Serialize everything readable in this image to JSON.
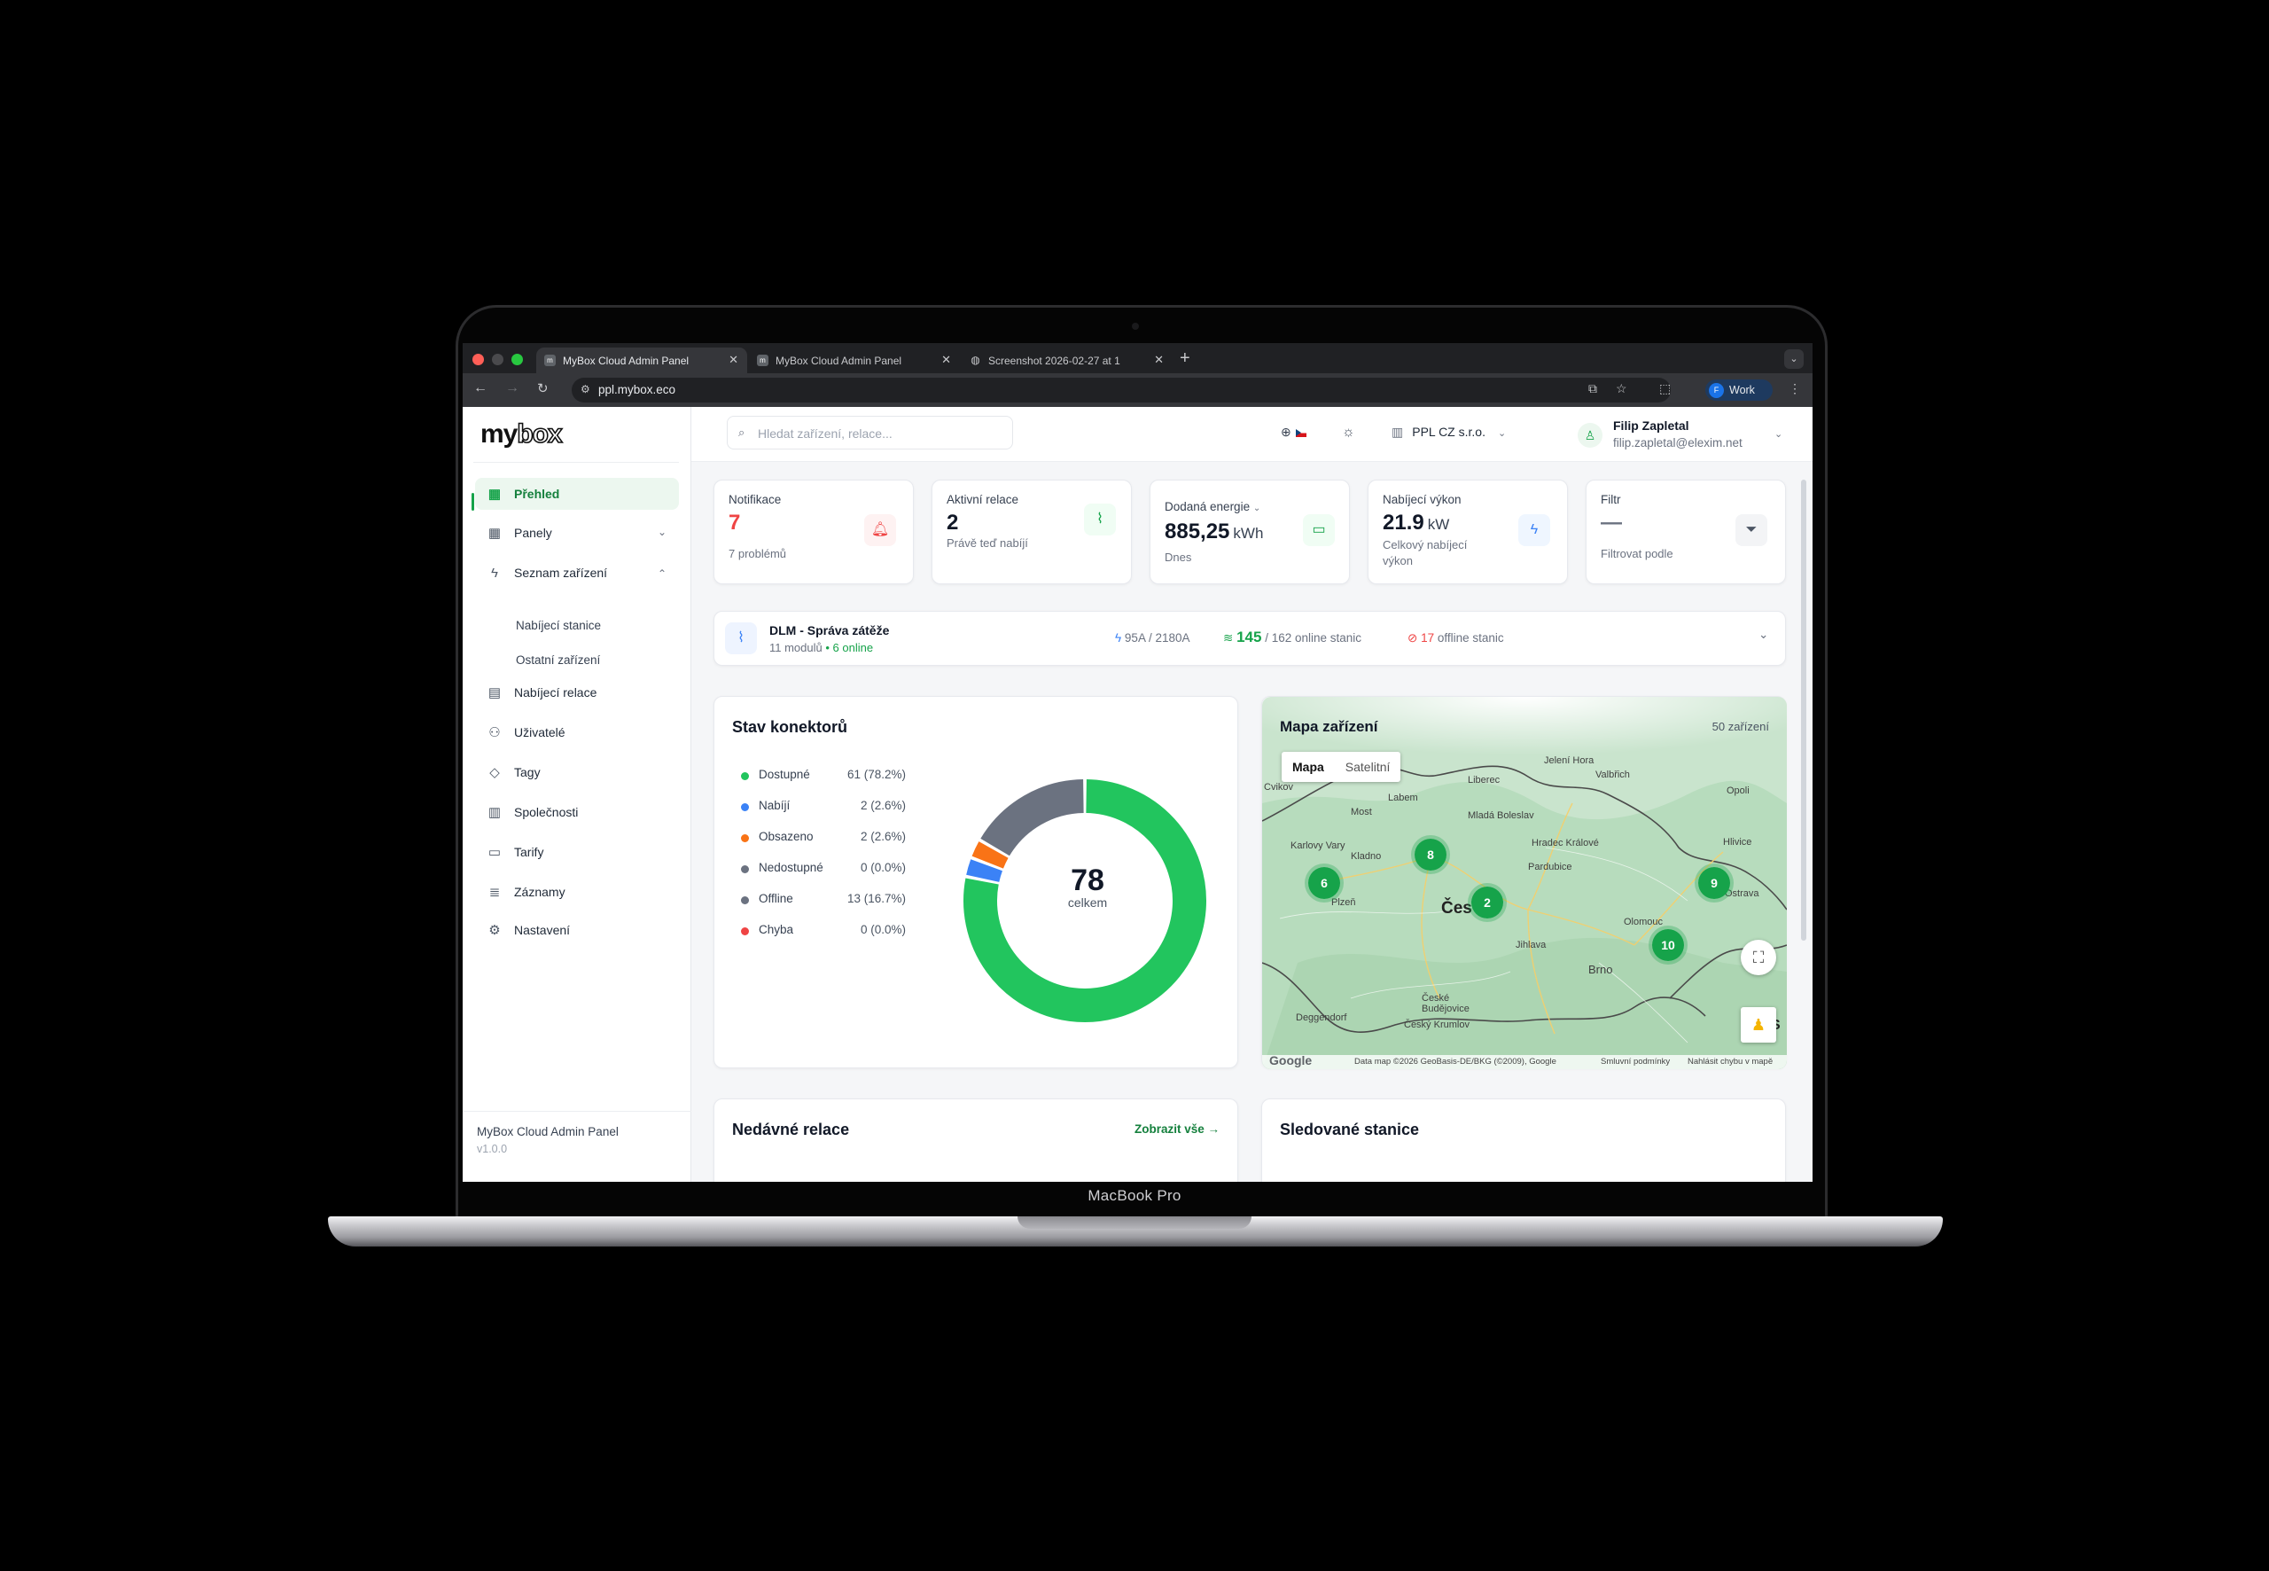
{
  "device": {
    "label": "MacBook Pro"
  },
  "browser": {
    "tabs": [
      {
        "title": "MyBox Cloud Admin Panel",
        "favicon": "mybox-favicon"
      },
      {
        "title": "MyBox Cloud Admin Panel",
        "favicon": "mybox-favicon"
      },
      {
        "title": "Screenshot 2026-02-27 at 1",
        "favicon": "globe-icon"
      }
    ],
    "url": "ppl.mybox.eco",
    "profile_label": "Work",
    "profile_initial": "F"
  },
  "sidebar": {
    "logo_my": "my",
    "logo_box": "box",
    "items": [
      {
        "label": "Přehled",
        "icon": "dashboard-icon"
      },
      {
        "label": "Panely",
        "icon": "grid-icon"
      },
      {
        "label": "Seznam zařízení",
        "icon": "lightning-icon"
      },
      {
        "label": "Nabíjecí relace",
        "icon": "document-icon"
      },
      {
        "label": "Uživatelé",
        "icon": "users-icon"
      },
      {
        "label": "Tagy",
        "icon": "tag-icon"
      },
      {
        "label": "Společnosti",
        "icon": "building-icon"
      },
      {
        "label": "Tarify",
        "icon": "card-icon"
      },
      {
        "label": "Záznamy",
        "icon": "log-icon"
      },
      {
        "label": "Nastavení",
        "icon": "gear-icon"
      }
    ],
    "subitems": [
      "Nabíjecí stanice",
      "Ostatní zařízení"
    ],
    "footer_title": "MyBox Cloud Admin Panel",
    "footer_version": "v1.0.0"
  },
  "topbar": {
    "search_placeholder": "Hledat zařízení, relace...",
    "company": "PPL CZ s.r.o.",
    "user_name": "Filip Zapletal",
    "user_email": "filip.zapletal@elexim.net"
  },
  "stats": [
    {
      "label": "Notifikace",
      "value": "7",
      "unit": "",
      "sub": "7 problémů",
      "icon": "bell-icon"
    },
    {
      "label": "Aktivní relace",
      "value": "2",
      "unit": "",
      "sub": "Právě teď nabíjí",
      "icon": "activity-icon"
    },
    {
      "label": "Dodaná energie",
      "value": "885,25",
      "unit": "kWh",
      "sub": "Dnes",
      "icon": "battery-icon"
    },
    {
      "label": "Nabíjecí výkon",
      "value": "21.9",
      "unit": "kW",
      "sub": "Celkový nabíjecí výkon",
      "icon": "lightning-icon"
    },
    {
      "label": "Filtr",
      "value": "—",
      "unit": "",
      "sub": "Filtrovat podle",
      "icon": "filter-icon"
    }
  ],
  "dlm": {
    "title": "DLM - Správa zátěže",
    "modules": "11 modulů",
    "online": "• 6 online",
    "current": "95A",
    "current_max": "/ 2180A",
    "online_count": "145",
    "online_total": "/ 162 online stanic",
    "offline_count": "17",
    "offline_label": "offline stanic"
  },
  "connectors": {
    "title": "Stav konektorů",
    "total": "78",
    "total_label": "celkem",
    "legend": [
      {
        "label": "Dostupné",
        "value": "61 (78.2%)",
        "color": "#22c55e",
        "count": 61
      },
      {
        "label": "Nabíjí",
        "value": "2 (2.6%)",
        "color": "#3b82f6",
        "count": 2
      },
      {
        "label": "Obsazeno",
        "value": "2 (2.6%)",
        "color": "#f97316",
        "count": 2
      },
      {
        "label": "Nedostupné",
        "value": "0 (0.0%)",
        "color": "#6b7280",
        "count": 0
      },
      {
        "label": "Offline",
        "value": "13 (16.7%)",
        "color": "#6b7280",
        "count": 13
      },
      {
        "label": "Chyba",
        "value": "0 (0.0%)",
        "color": "#ef4444",
        "count": 0
      }
    ]
  },
  "map": {
    "title": "Mapa zařízení",
    "count": "50 zařízení",
    "toggle": [
      "Mapa",
      "Satelitní"
    ],
    "clusters": [
      "6",
      "8",
      "2",
      "9",
      "10"
    ],
    "cities": [
      "Cvikov",
      "Liberec",
      "Jelení Hora",
      "Valbřich",
      "Opoli",
      "Mladá Boleslav",
      "Hradec Králové",
      "Pardubice",
      "Karlovy Vary",
      "Kladno",
      "Most",
      "Plzeň",
      "Čes",
      "Jihlava",
      "Olomouc",
      "Ostrava",
      "Hlivice",
      "Brno",
      "České Budějovice",
      "Český Krumlov",
      "Deggendorf",
      "Labem",
      "S"
    ],
    "attribution": "Data map ©2026 GeoBasis-DE/BKG (©2009), Google",
    "terms": "Smluvní podmínky",
    "report": "Nahlásit chybu v mapě",
    "google": "Google"
  },
  "recent": {
    "title": "Nedávné relace",
    "link": "Zobrazit vše →"
  },
  "watched": {
    "title": "Sledované stanice"
  }
}
